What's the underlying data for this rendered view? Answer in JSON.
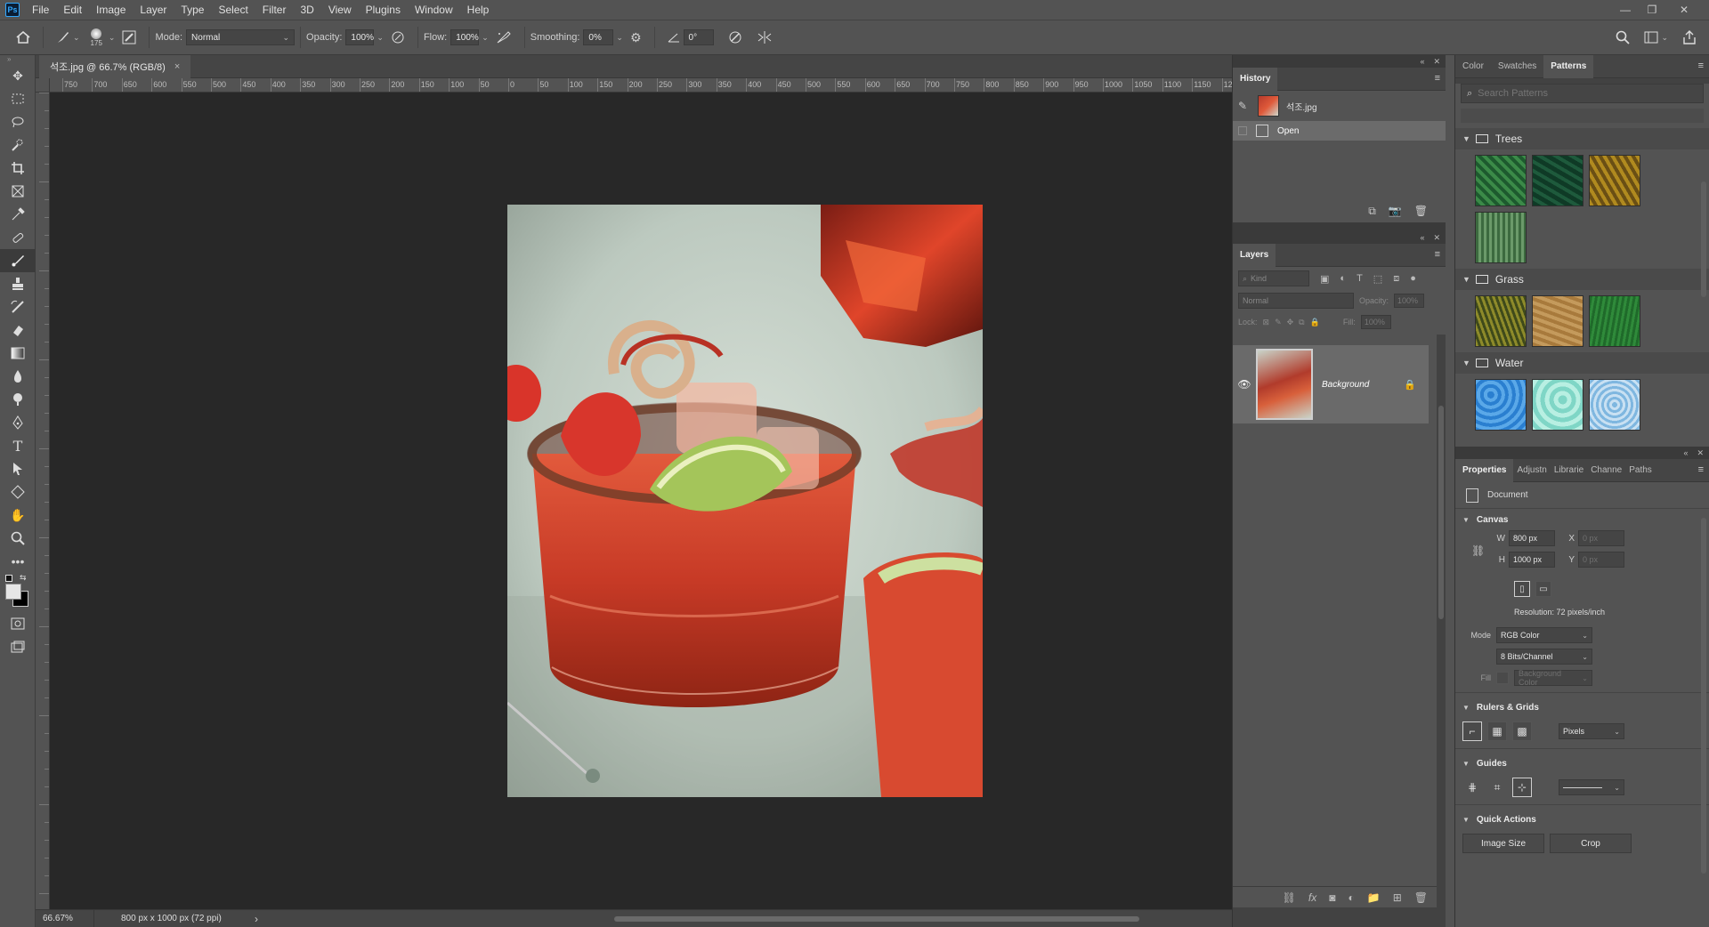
{
  "app": {
    "logo": "Ps",
    "menu": [
      "File",
      "Edit",
      "Image",
      "Layer",
      "Type",
      "Select",
      "Filter",
      "3D",
      "View",
      "Plugins",
      "Window",
      "Help"
    ],
    "window_controls": [
      "—",
      "❐",
      "✕"
    ]
  },
  "options": {
    "brush_size": "175",
    "mode_label": "Mode:",
    "mode_value": "Normal",
    "opacity_label": "Opacity:",
    "opacity_value": "100%",
    "flow_label": "Flow:",
    "flow_value": "100%",
    "smoothing_label": "Smoothing:",
    "smoothing_value": "0%",
    "angle_value": "0°"
  },
  "document": {
    "tab_title": "석조.jpg @ 66.7% (RGB/8)",
    "close": "×"
  },
  "ruler": {
    "h_ticks": [
      "750",
      "700",
      "650",
      "600",
      "550",
      "500",
      "450",
      "400",
      "350",
      "300",
      "250",
      "200",
      "150",
      "100",
      "50",
      "0",
      "50",
      "100",
      "150",
      "200",
      "250",
      "300",
      "350",
      "400",
      "450",
      "500",
      "550",
      "600",
      "650",
      "700",
      "750",
      "800",
      "850",
      "900",
      "950",
      "1000",
      "1050",
      "1100",
      "1150",
      "12"
    ]
  },
  "status": {
    "zoom": "66.67%",
    "doc_info": "800 px x 1000 px (72 ppi)",
    "arrow": "›"
  },
  "history": {
    "tab": "History",
    "snapshot_name": "석조.jpg",
    "states": [
      "Open"
    ]
  },
  "layers": {
    "tab": "Layers",
    "filter_kind": "Kind",
    "blend_mode": "Normal",
    "opacity_label": "Opacity:",
    "opacity_value": "100%",
    "lock_label": "Lock:",
    "fill_label": "Fill:",
    "fill_value": "100%",
    "layer_name": "Background"
  },
  "patterns": {
    "tabs": [
      "Color",
      "Swatches",
      "Patterns"
    ],
    "active_tab": "Patterns",
    "search_placeholder": "Search Patterns",
    "groups": [
      {
        "name": "Trees",
        "colors": [
          "#1d5a2e",
          "#0f3a26",
          "#b08a1f",
          "#3c6a3f"
        ]
      },
      {
        "name": "Grass",
        "colors": [
          "#8d8a2a",
          "#a87a3c",
          "#1f6a2a"
        ]
      },
      {
        "name": "Water",
        "colors": [
          "#2a7fd0",
          "#7fd6c6",
          "#7fb7e0"
        ]
      }
    ]
  },
  "properties": {
    "tabs": [
      "Properties",
      "Adjustn",
      "Librarie",
      "Channe",
      "Paths"
    ],
    "active_tab": "Properties",
    "doc_label": "Document",
    "canvas_title": "Canvas",
    "w_label": "W",
    "w_value": "800 px",
    "h_label": "H",
    "h_value": "1000 px",
    "x_label": "X",
    "x_value": "0 px",
    "y_label": "Y",
    "y_value": "0 px",
    "resolution": "Resolution: 72 pixels/inch",
    "mode_label": "Mode",
    "mode_value": "RGB Color",
    "bits_value": "8 Bits/Channel",
    "fill_label": "Fill",
    "fill_value": "Background Color",
    "rulers_title": "Rulers & Grids",
    "units_value": "Pixels",
    "guides_title": "Guides",
    "quick_actions_title": "Quick Actions",
    "image_size_btn": "Image Size",
    "crop_btn": "Crop"
  }
}
